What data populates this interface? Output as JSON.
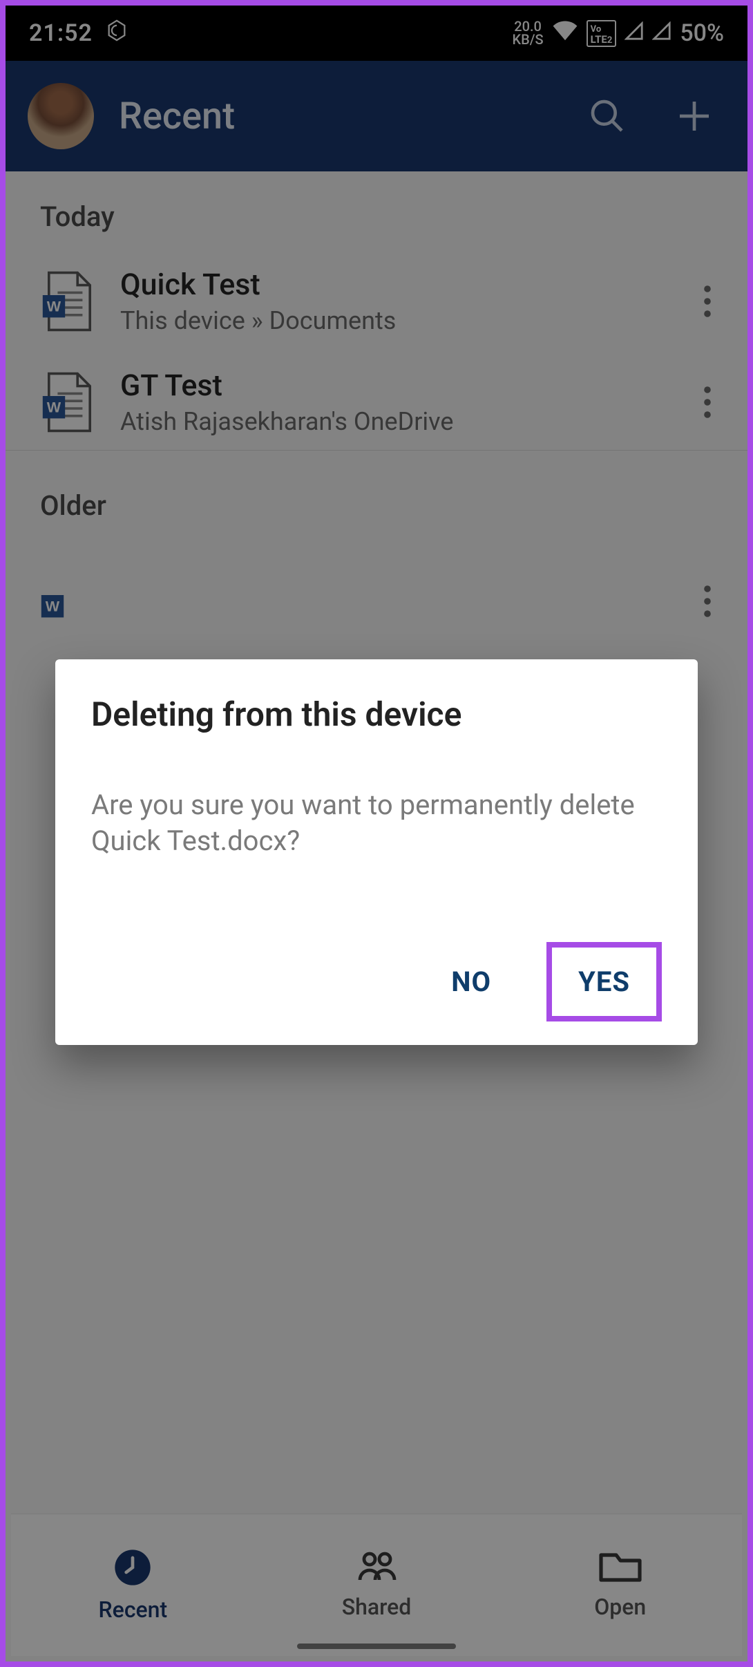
{
  "status": {
    "time": "21:52",
    "net_speed_top": "20.0",
    "net_speed_bottom": "KB/S",
    "volte": "VoLTE 2",
    "battery": "50%"
  },
  "header": {
    "title": "Recent"
  },
  "sections": [
    {
      "title": "Today",
      "files": [
        {
          "name": "Quick Test",
          "location": "This device » Documents"
        },
        {
          "name": "GT Test",
          "location": "Atish Rajasekharan's OneDrive"
        }
      ]
    },
    {
      "title": "Older",
      "files": []
    }
  ],
  "dialog": {
    "title": "Deleting from this device",
    "message": "Are you sure you want to permanently delete Quick Test.docx?",
    "no_label": "NO",
    "yes_label": "YES"
  },
  "nav": {
    "recent": "Recent",
    "shared": "Shared",
    "open": "Open"
  }
}
